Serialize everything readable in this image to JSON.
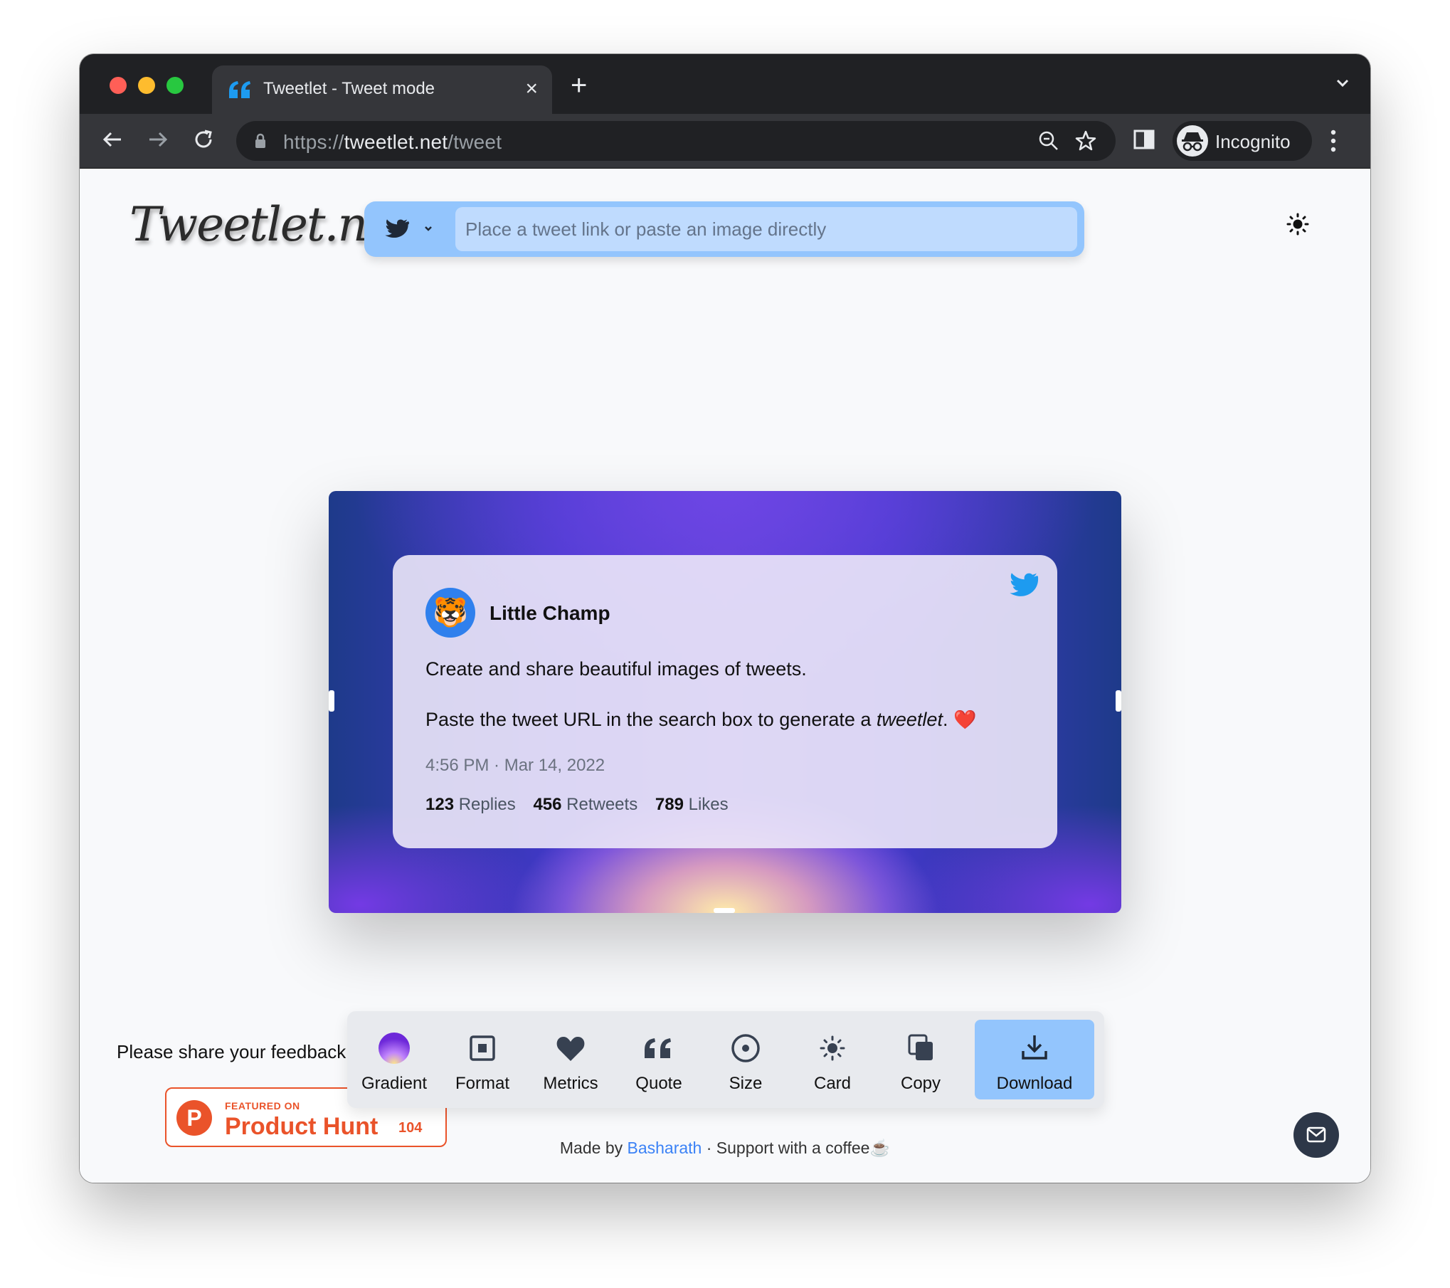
{
  "browser": {
    "tab_title": "Tweetlet - Tweet mode",
    "url_scheme": "https://",
    "url_host": "tweetlet.net",
    "url_path": "/tweet",
    "profile_label": "Incognito"
  },
  "page": {
    "logo": "Tweetlet.net",
    "search_placeholder": "Place a tweet link or paste an image directly"
  },
  "tweet": {
    "avatar_emoji": "🐯",
    "author": "Little Champ",
    "paragraph1": "Create and share beautiful images of tweets.",
    "paragraph2_prefix": "Paste the tweet URL in the search box to generate a ",
    "paragraph2_emphasis": "tweetlet",
    "paragraph2_suffix": ". ",
    "heart": "❤️",
    "time": "4:56 PM · Mar 14, 2022",
    "metrics": [
      {
        "count": "123",
        "label": "Replies"
      },
      {
        "count": "456",
        "label": "Retweets"
      },
      {
        "count": "789",
        "label": "Likes"
      }
    ]
  },
  "feedback": {
    "text": "Please share your feedback",
    "ph_small": "FEATURED ON",
    "ph_big": "Product Hunt",
    "ph_count": "104"
  },
  "controls": [
    {
      "label": "Gradient",
      "icon": "gradient-icon"
    },
    {
      "label": "Format",
      "icon": "format-icon"
    },
    {
      "label": "Metrics",
      "icon": "heart-icon"
    },
    {
      "label": "Quote",
      "icon": "quote-icon"
    },
    {
      "label": "Size",
      "icon": "size-icon"
    },
    {
      "label": "Card",
      "icon": "sun-icon"
    },
    {
      "label": "Copy",
      "icon": "copy-icon"
    },
    {
      "label": "Download",
      "icon": "download-icon"
    }
  ],
  "footer": {
    "made_by": "Made by ",
    "author": "Basharath",
    "support": " · Support with a coffee",
    "coffee": "☕"
  },
  "colors": {
    "accent_blue": "#93c5fd",
    "twitter_blue": "#1d9bf0",
    "product_hunt": "#ea532a"
  }
}
